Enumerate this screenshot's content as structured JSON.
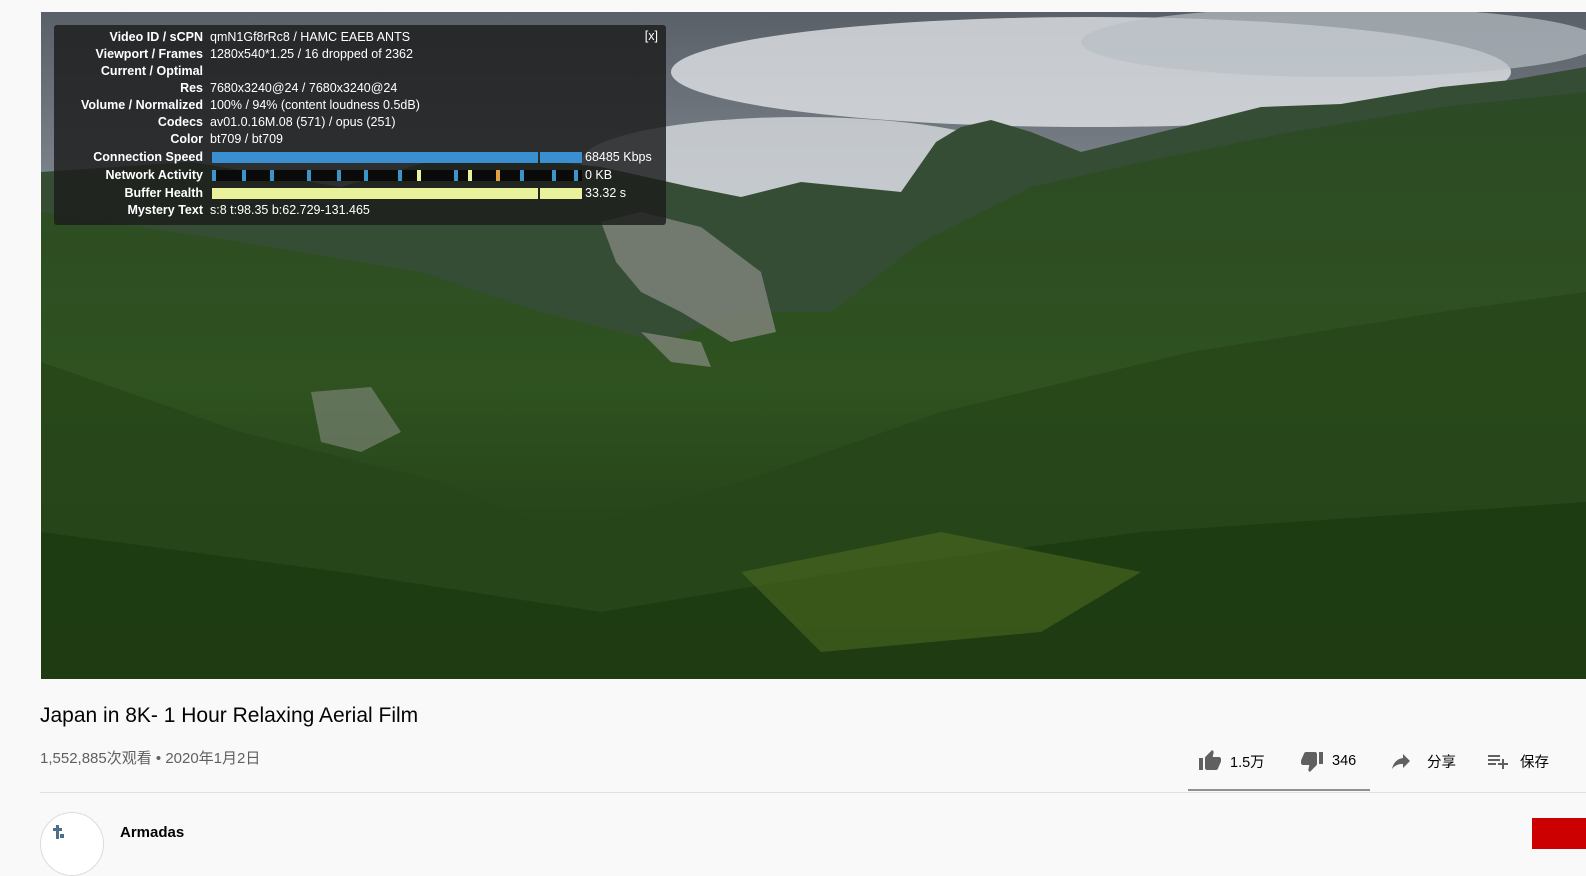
{
  "stats_for_nerds": {
    "close_label": "[x]",
    "rows": [
      {
        "label": "Video ID / sCPN",
        "value": "qmN1Gf8rRc8 / HAMC EAEB ANTS"
      },
      {
        "label": "Viewport / Frames",
        "value": "1280x540*1.25 / 16 dropped of 2362"
      },
      {
        "label": "Current / Optimal",
        "value": ""
      },
      {
        "label": "Res",
        "value": "7680x3240@24 / 7680x3240@24"
      },
      {
        "label": "Volume / Normalized",
        "value": "100% / 94% (content loudness 0.5dB)"
      },
      {
        "label": "Codecs",
        "value": "av01.0.16M.08 (571) / opus (251)"
      },
      {
        "label": "Color",
        "value": "bt709 / bt709"
      },
      {
        "label": "Connection Speed",
        "value": "68485 Kbps"
      },
      {
        "label": "Network Activity",
        "value": "0 KB"
      },
      {
        "label": "Buffer Health",
        "value": "33.32 s"
      },
      {
        "label": "Mystery Text",
        "value": "s:8 t:98.35 b:62.729-131.465"
      }
    ],
    "colors": {
      "connection": "#3a8fd1",
      "buffer": "#e9f29a",
      "network_tick": "#3c95c8"
    }
  },
  "video": {
    "title": "Japan in 8K- 1 Hour Relaxing Aerial Film",
    "meta": "1,552,885次观看 • 2020年1月2日"
  },
  "actions": {
    "like_count": "1.5万",
    "dislike_count": "346",
    "share_label": "分享",
    "save_label": "保存"
  },
  "channel": {
    "name": "Armadas"
  },
  "colors": {
    "subscribe": "#cc0000",
    "background": "#f9f9f9"
  }
}
